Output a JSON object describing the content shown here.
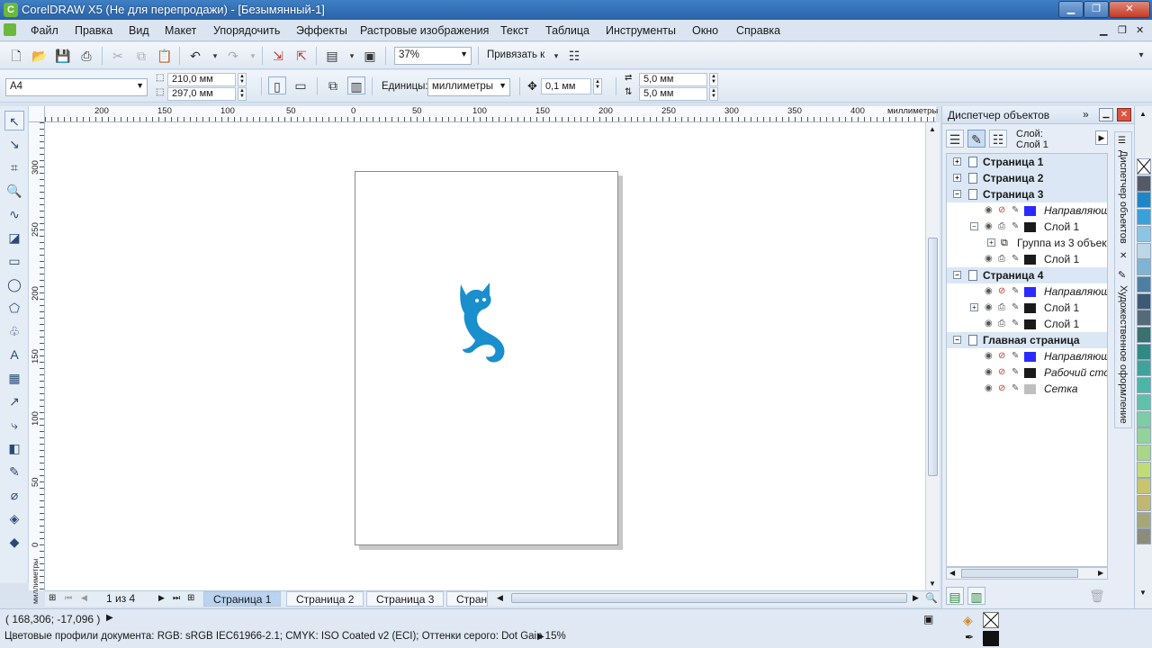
{
  "window": {
    "title": "CorelDRAW X5 (Не для перепродажи) - [Безымянный-1]",
    "app_icon": "coreldraw-app-icon"
  },
  "menu": [
    "Файл",
    "Правка",
    "Вид",
    "Макет",
    "Упорядочить",
    "Эффекты",
    "Растровые изображения",
    "Текст",
    "Таблица",
    "Инструменты",
    "Окно",
    "Справка"
  ],
  "toolbar": {
    "zoom_value": "37%",
    "snap_label": "Привязать к"
  },
  "property_bar": {
    "paper_type": "A4",
    "width": "210,0 мм",
    "height": "297,0 мм",
    "units_label": "Единицы:",
    "units_value": "миллиметры",
    "nudge": "0,1 мм",
    "dup_x": "5,0 мм",
    "dup_y": "5,0 мм"
  },
  "ruler": {
    "h_labels": [
      "200",
      "150",
      "100",
      "50",
      "0",
      "50",
      "100",
      "150",
      "200",
      "250",
      "300",
      "350",
      "400"
    ],
    "h_unit": "миллиметры",
    "v_labels": [
      "300",
      "250",
      "200",
      "150",
      "100",
      "50",
      "0"
    ],
    "v_unit": "миллиметры"
  },
  "page_nav": {
    "counter": "1 из 4",
    "tabs": [
      "Страница 1",
      "Страница 2",
      "Страница 3",
      "Стран"
    ],
    "active_tab": 0
  },
  "status": {
    "coords": "( 168,306; -17,096 )",
    "color_profiles": "Цветовые профили документа: RGB: sRGB IEC61966-2.1; CMYK: ISO Coated v2 (ECI); Оттенки серого: Dot Gain 15%"
  },
  "docker": {
    "title": "Диспетчер объектов",
    "layer_label_1": "Слой:",
    "layer_label_2": "Слой 1",
    "tree": [
      {
        "kind": "page",
        "label": "Страница 1",
        "expander": "+"
      },
      {
        "kind": "page",
        "label": "Страница 2",
        "expander": "+"
      },
      {
        "kind": "page",
        "label": "Страница 3",
        "expander": "−"
      },
      {
        "kind": "layer",
        "label": "Направляющ",
        "italic": true,
        "swatch": "#2b2bff",
        "locked": true
      },
      {
        "kind": "layer",
        "label": "Слой 1",
        "italic": false,
        "swatch": "#1a1a1a",
        "expander": "−"
      },
      {
        "kind": "group",
        "label": "Группа из 3 объект",
        "expander": "+"
      },
      {
        "kind": "layer",
        "label": "Слой 1",
        "italic": false,
        "swatch": "#1a1a1a"
      },
      {
        "kind": "page",
        "label": "Страница 4",
        "expander": "−"
      },
      {
        "kind": "layer",
        "label": "Направляющ",
        "italic": true,
        "swatch": "#2b2bff",
        "locked": true
      },
      {
        "kind": "layer",
        "label": "Слой 1",
        "italic": false,
        "swatch": "#1a1a1a",
        "expander": "+"
      },
      {
        "kind": "layer",
        "label": "Слой 1",
        "italic": false,
        "swatch": "#1a1a1a"
      },
      {
        "kind": "page",
        "label": "Главная страница",
        "expander": "−"
      },
      {
        "kind": "layer",
        "label": "Направляющ",
        "italic": true,
        "swatch": "#2b2bff",
        "locked": true
      },
      {
        "kind": "layer",
        "label": "Рабочий сто",
        "italic": true,
        "swatch": "#1a1a1a",
        "locked": true
      },
      {
        "kind": "layer",
        "label": "Сетка",
        "italic": true,
        "swatch": "#bfbfbf",
        "locked": true
      }
    ],
    "side_tab_1": "Диспетчер объектов",
    "side_tab_2": "Художественное оформление"
  },
  "palette": [
    "none",
    "#555a66",
    "#1f86c6",
    "#3aa0d8",
    "#8cc4e3",
    "#bcd7ea",
    "#7fb4d3",
    "#4d7fa3",
    "#3c5a74",
    "#566a78",
    "#3b7070",
    "#2f8a86",
    "#3fa39b",
    "#4cb5a6",
    "#60c1aa",
    "#7dcca5",
    "#93d29a",
    "#a9d688",
    "#bfdc78",
    "#c9c46f",
    "#bfb873",
    "#a7a67a",
    "#8b8c7c"
  ],
  "colors": {
    "accent": "#1e8fc8",
    "logo_fill": "#1a8fcd"
  }
}
